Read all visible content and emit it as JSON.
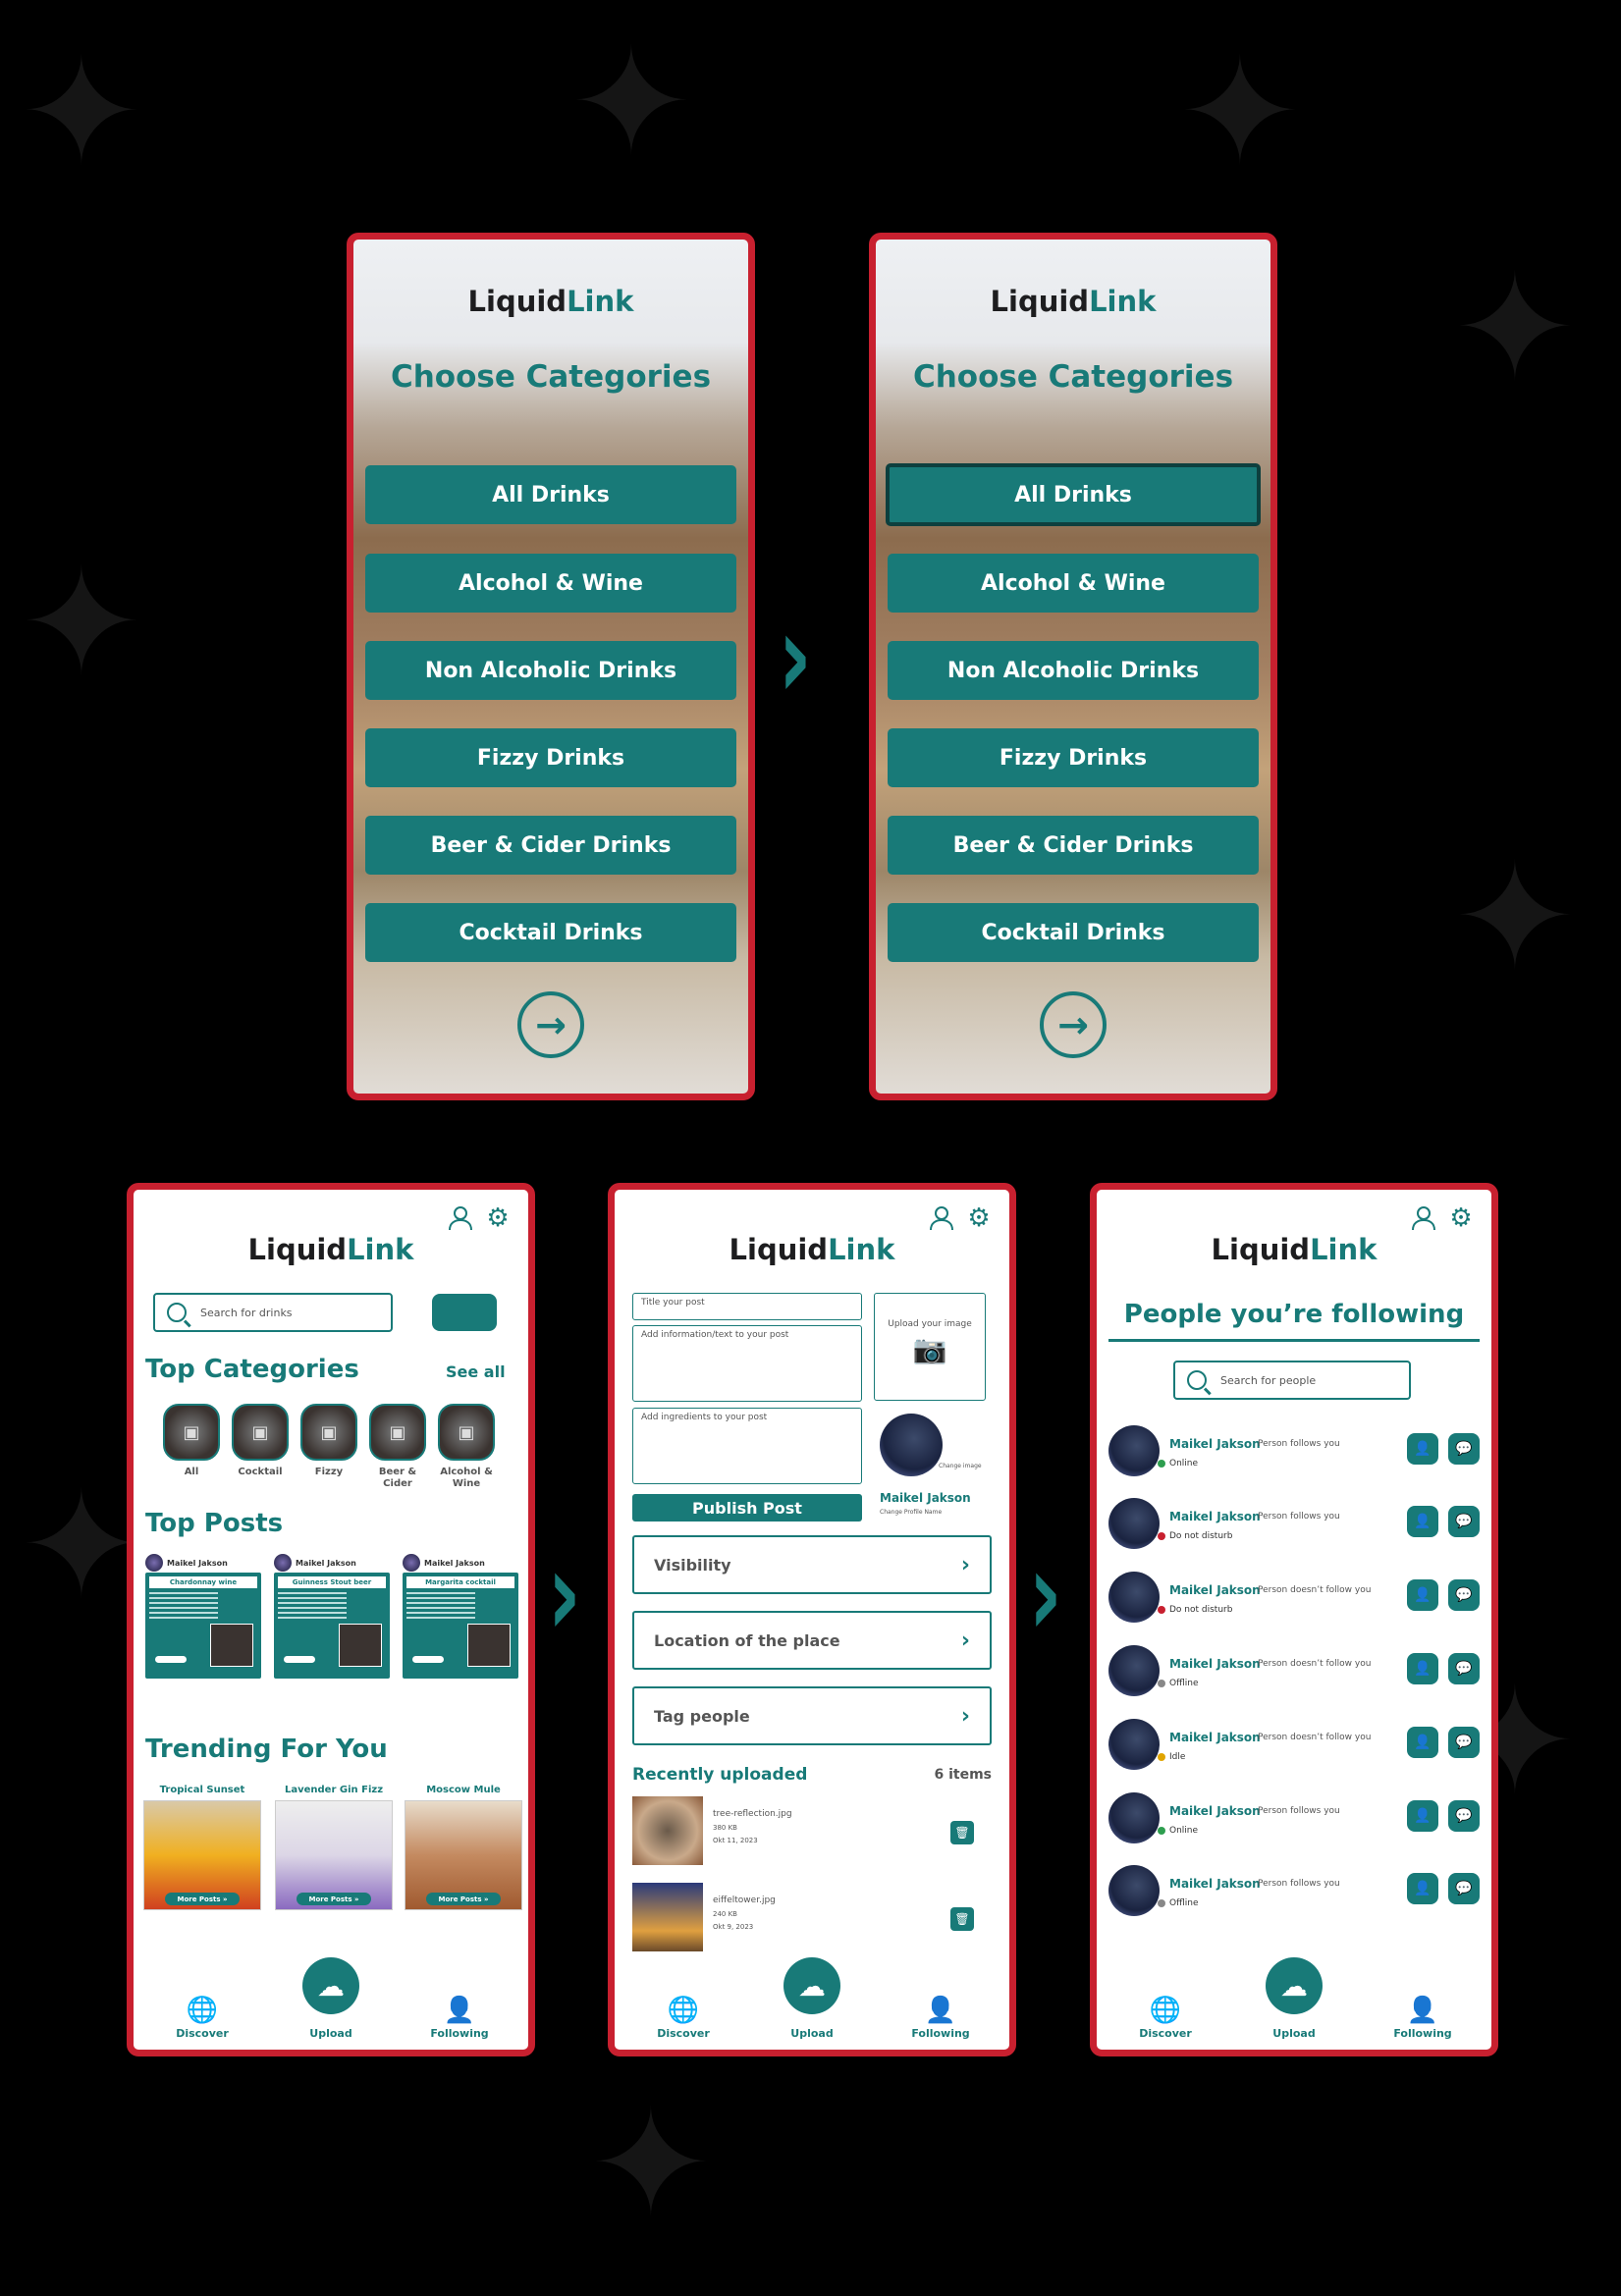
{
  "brand": {
    "part1": "Liquid",
    "part2": "Link"
  },
  "choose": {
    "title": "Choose Categories",
    "buttons": [
      "All Drinks",
      "Alcohol & Wine",
      "Non Alcoholic Drinks",
      "Fizzy Drinks",
      "Beer & Cider Drinks",
      "Cocktail Drinks"
    ],
    "selected": "All Drinks"
  },
  "discover": {
    "search_placeholder": "Search for drinks",
    "top_categories": "Top Categories",
    "see_all": "See all",
    "categories": [
      "All",
      "Cocktail",
      "Fizzy",
      "Beer & Cider",
      "Alcohol & Wine"
    ],
    "top_posts": "Top Posts",
    "posts": [
      {
        "user": "Maikel Jakson",
        "title": "Chardonnay wine"
      },
      {
        "user": "Maikel Jakson",
        "title": "Guinness Stout beer"
      },
      {
        "user": "Maikel Jakson",
        "title": "Margarita cocktail"
      }
    ],
    "trending": "Trending For You",
    "trend_items": [
      "Tropical Sunset",
      "Lavender Gin Fizz",
      "Moscow Mule"
    ],
    "more_posts": "More Posts »"
  },
  "upload": {
    "title_placeholder": "Title your post",
    "info_placeholder": "Add information/text to your post",
    "ingredients_placeholder": "Add ingredients to your post",
    "upload_image": "Upload your image",
    "change_image": "Change image",
    "user_name": "Maikel Jakson",
    "change_profile_name": "Change Profile Name",
    "publish": "Publish Post",
    "rows": [
      "Visibility",
      "Location of the place",
      "Tag people"
    ],
    "recent_title": "Recently uploaded",
    "recent_count": "6 items",
    "files": [
      {
        "name": "tree-reflection.jpg",
        "size": "380 KB",
        "date": "Okt 11, 2023"
      },
      {
        "name": "eiffeltower.jpg",
        "size": "240 KB",
        "date": "Okt 9, 2023"
      }
    ]
  },
  "following": {
    "title": "People you’re following",
    "search_placeholder": "Search for people",
    "people": [
      {
        "name": "Maikel Jakson",
        "rel": "Person follows you",
        "status": "Online",
        "color": "#2e9e4f"
      },
      {
        "name": "Maikel Jakson",
        "rel": "Person follows you",
        "status": "Do not disturb",
        "color": "#c8202f"
      },
      {
        "name": "Maikel Jakson",
        "rel": "Person doesn’t follow you",
        "status": "Do not disturb",
        "color": "#c8202f"
      },
      {
        "name": "Maikel Jakson",
        "rel": "Person doesn’t follow you",
        "status": "Offline",
        "color": "#888888"
      },
      {
        "name": "Maikel Jakson",
        "rel": "Person doesn’t follow you",
        "status": "Idle",
        "color": "#e0a400"
      },
      {
        "name": "Maikel Jakson",
        "rel": "Person follows you",
        "status": "Online",
        "color": "#2e9e4f"
      },
      {
        "name": "Maikel Jakson",
        "rel": "Person follows you",
        "status": "Offline",
        "color": "#888888"
      }
    ]
  },
  "nav": {
    "discover": "Discover",
    "upload": "Upload",
    "following": "Following"
  },
  "colors": {
    "teal": "#187a78",
    "frame": "#c8202f",
    "background": "#000000"
  }
}
